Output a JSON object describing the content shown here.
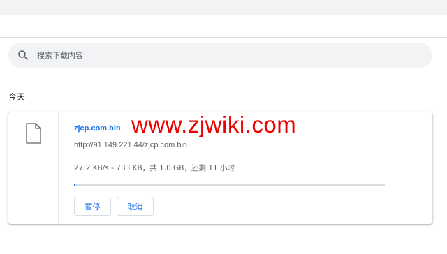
{
  "search": {
    "placeholder": "搜索下载内容"
  },
  "section": {
    "date_label": "今天"
  },
  "download": {
    "file_name": "zjcp.com.bin",
    "url": "http://91.149.221.44/zjcp.com.bin",
    "status": "27.2 KB/s - 733 KB，共 1.0 GB，还剩 11 小时",
    "progress_percent": 0.07,
    "icon": "file-icon",
    "buttons": {
      "pause": "暂停",
      "cancel": "取消"
    }
  },
  "watermark": {
    "text": "www.zjwiki.com"
  },
  "colors": {
    "accent": "#1a73e8",
    "watermark": "#ee0000",
    "surface": "#f1f3f4"
  }
}
